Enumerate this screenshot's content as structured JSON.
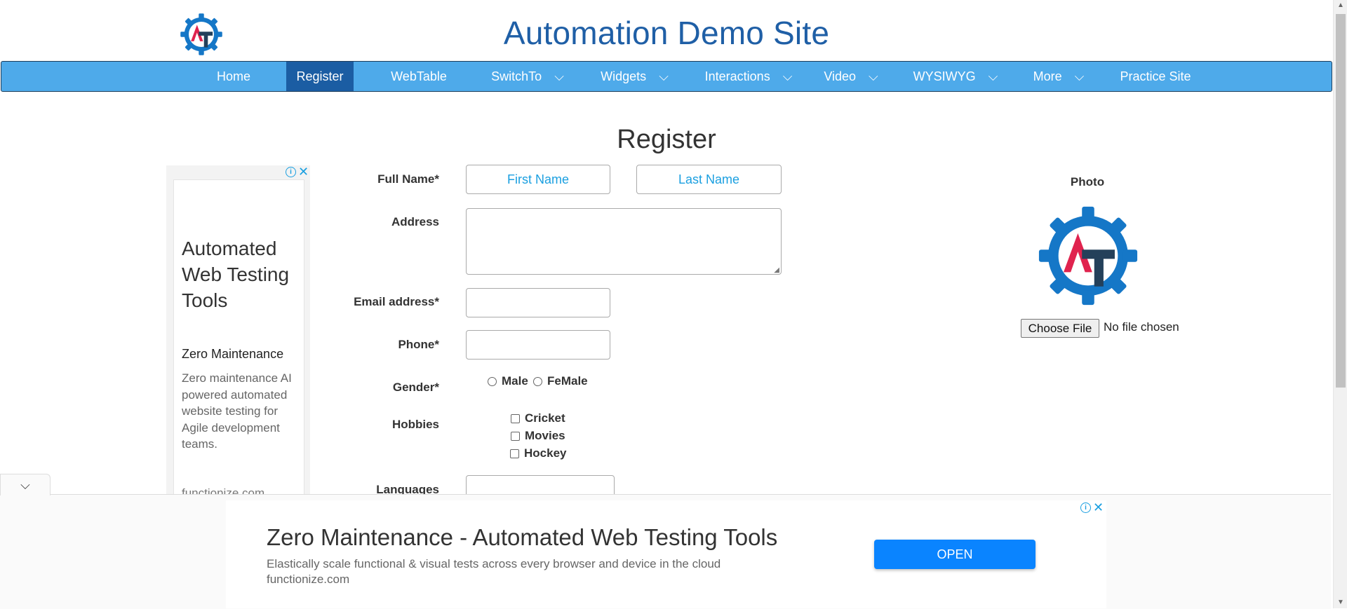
{
  "header": {
    "title": "Automation Demo Site"
  },
  "nav": {
    "items": [
      {
        "label": "Home"
      },
      {
        "label": "Register"
      },
      {
        "label": "WebTable"
      },
      {
        "label": "SwitchTo"
      },
      {
        "label": "Widgets"
      },
      {
        "label": "Interactions"
      },
      {
        "label": "Video"
      },
      {
        "label": "WYSIWYG"
      },
      {
        "label": "More"
      },
      {
        "label": "Practice Site"
      }
    ],
    "active": "Register",
    "dropdown_icon": "chevron-down-icon"
  },
  "form": {
    "heading": "Register",
    "full_name_label": "Full Name*",
    "first_name_placeholder": "First Name",
    "last_name_placeholder": "Last Name",
    "address_label": "Address",
    "email_label": "Email address*",
    "phone_label": "Phone*",
    "gender_label": "Gender*",
    "gender_options": [
      "Male",
      "FeMale"
    ],
    "hobbies_label": "Hobbies",
    "hobbies": [
      "Cricket",
      "Movies",
      "Hockey"
    ],
    "languages_label": "Languages"
  },
  "photo": {
    "label": "Photo",
    "choose_file_label": "Choose File",
    "no_file_text": "No file chosen"
  },
  "side_ad": {
    "title": "Automated Web Testing Tools",
    "subtitle": "Zero Maintenance",
    "description": "Zero maintenance AI powered automated website testing for Agile development teams.",
    "domain": "functionize.com"
  },
  "bottom_ad": {
    "title": "Zero Maintenance - Automated Web Testing Tools",
    "description": "Elastically scale functional & visual tests across every browser and device in the cloud",
    "domain": "functionize.com",
    "button_label": "OPEN"
  },
  "colors": {
    "nav_bg": "#4eaaea",
    "nav_active": "#1b5da3",
    "title": "#1f5fa6",
    "logo_blue": "#1577c7",
    "logo_red": "#e0234e",
    "logo_navy": "#24405a",
    "open_button": "#0a84ff"
  }
}
